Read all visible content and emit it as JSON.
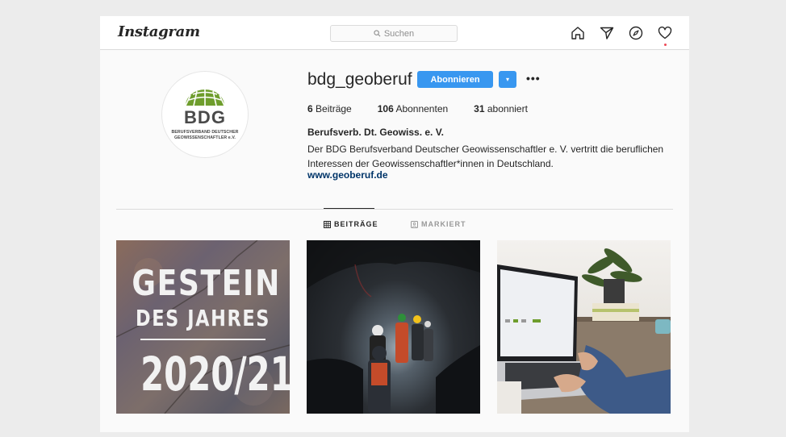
{
  "app": {
    "logo": "Instagram"
  },
  "search": {
    "placeholder": "Suchen"
  },
  "nav": {
    "icons": [
      "home-icon",
      "direct-icon",
      "explore-icon",
      "activity-heart-icon"
    ],
    "notification_color": "#ed4956"
  },
  "profile": {
    "username": "bdg_geoberuf",
    "follow_label": "Abonnieren",
    "dropdown_glyph": "▾",
    "more_glyph": "•••",
    "avatar": {
      "logo_letters": "BDG",
      "subtitle_line1": "BERUFSVERBAND DEUTSCHER",
      "subtitle_line2": "GEOWISSENSCHAFTLER e.V."
    },
    "stats": [
      {
        "count": "6",
        "label": "Beiträge"
      },
      {
        "count": "106",
        "label": "Abonnenten"
      },
      {
        "count": "31",
        "label": "abonniert"
      }
    ],
    "full_name": "Berufsverb. Dt. Geowiss. e. V.",
    "bio": "Der BDG Berufsverband Deutscher Geowissenschaftler e. V. vertritt die beruflichen Interessen der Geowissenschaftler*innen in Deutschland.",
    "website": "www.geoberuf.de"
  },
  "tabs": [
    {
      "label": "BEITRÄGE",
      "icon": "grid-icon",
      "active": true
    },
    {
      "label": "MARKIERT",
      "icon": "tagged-icon",
      "active": false
    }
  ],
  "posts": [
    {
      "kind": "text-graphic",
      "line1": "GESTEIN",
      "line2": "DES JAHRES",
      "line3": "2020/21"
    },
    {
      "kind": "photo",
      "description_icon": "cave-photo"
    },
    {
      "kind": "photo",
      "description_icon": "laptop-photo"
    }
  ],
  "colors": {
    "accent": "#3897f0",
    "brand_green": "#6e9d2c",
    "link": "#003569"
  }
}
